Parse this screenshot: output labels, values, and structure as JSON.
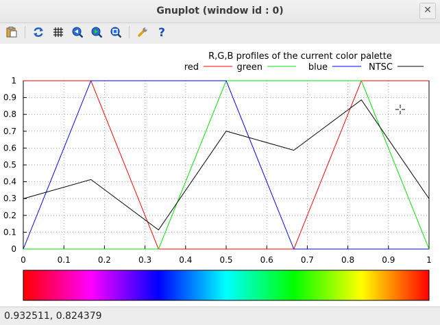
{
  "window": {
    "title": "Gnuplot (window id : 0)"
  },
  "toolbar": {
    "buttons": [
      {
        "name": "copy-to-clipboard",
        "icon": "clipboard-icon"
      },
      {
        "name": "replot",
        "icon": "refresh-icon"
      },
      {
        "name": "toggle-grid",
        "icon": "grid-icon"
      },
      {
        "name": "zoom-previous",
        "icon": "zoom-previous-icon"
      },
      {
        "name": "zoom-next",
        "icon": "zoom-next-icon"
      },
      {
        "name": "autoscale",
        "icon": "zoom-fit-icon"
      },
      {
        "name": "settings",
        "icon": "wrench-icon"
      },
      {
        "name": "help",
        "icon": "help-icon"
      }
    ]
  },
  "status": {
    "coordinates": "0.932511,  0.824379"
  },
  "colors": {
    "red": "#ff0000",
    "green": "#00e000",
    "blue": "#0000ff",
    "ntsc": "#000000",
    "grid": "#a0a0a0"
  },
  "chart_data": {
    "type": "line",
    "title": "R,G,B profiles of the current color palette",
    "xlim": [
      0,
      1
    ],
    "ylim": [
      0,
      1
    ],
    "xticks": [
      "0",
      "0.1",
      "0.2",
      "0.3",
      "0.4",
      "0.5",
      "0.6",
      "0.7",
      "0.8",
      "0.9",
      "1"
    ],
    "yticks": [
      "0",
      "0.1",
      "0.2",
      "0.3",
      "0.4",
      "0.5",
      "0.6",
      "0.7",
      "0.8",
      "0.9",
      "1"
    ],
    "grid": true,
    "legend_position": "top-right",
    "series": [
      {
        "name": "red",
        "color": "#ff0000",
        "x": [
          0,
          0.1667,
          0.3333,
          0.6667,
          0.8333,
          1
        ],
        "y": [
          1,
          1,
          0,
          0,
          1,
          1
        ]
      },
      {
        "name": "green",
        "color": "#00e000",
        "x": [
          0,
          0.3333,
          0.5,
          0.8333,
          1
        ],
        "y": [
          0,
          0,
          1,
          1,
          0
        ]
      },
      {
        "name": "blue",
        "color": "#0000ff",
        "x": [
          0,
          0.1667,
          0.5,
          0.6667,
          1
        ],
        "y": [
          0,
          1,
          1,
          0,
          0
        ]
      },
      {
        "name": "NTSC",
        "color": "#000000",
        "x": [
          0,
          0.1667,
          0.3333,
          0.5,
          0.6667,
          0.8333,
          1
        ],
        "y": [
          0.299,
          0.413,
          0.114,
          0.701,
          0.587,
          0.886,
          0.299
        ]
      }
    ],
    "colorbar_stops": [
      "#ff0000",
      "#ff00ff",
      "#0000ff",
      "#00ffff",
      "#00ff00",
      "#ffff00",
      "#ff0000"
    ]
  }
}
